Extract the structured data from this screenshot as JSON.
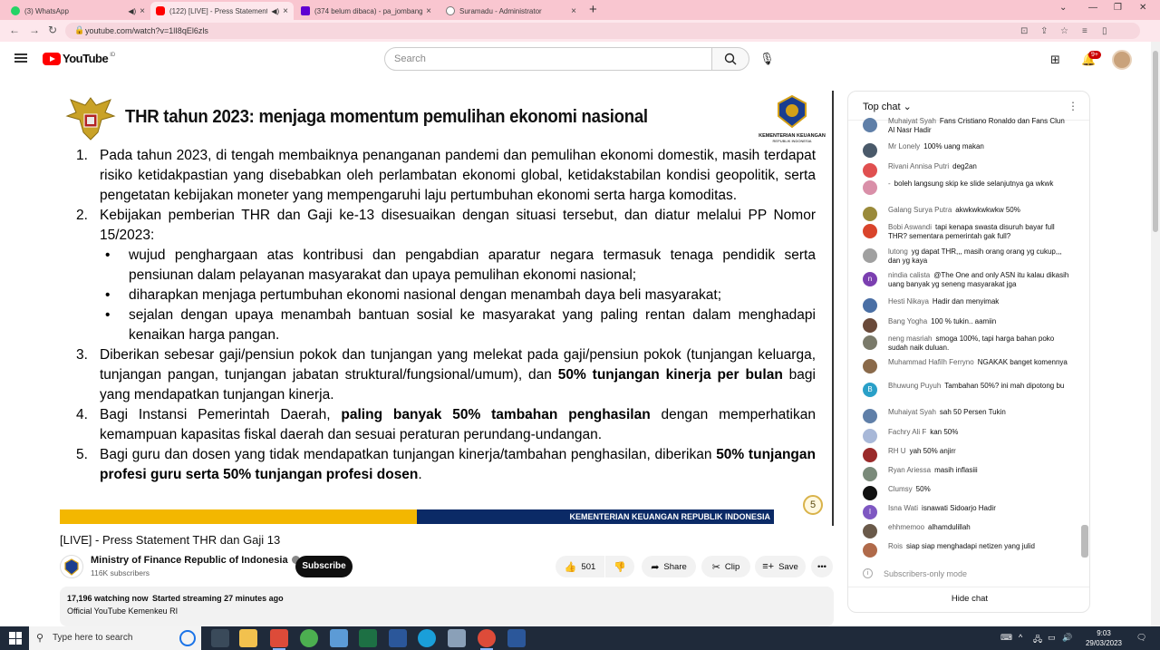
{
  "browser": {
    "tabs": [
      {
        "title": "(3) WhatsApp",
        "color": "#25d366"
      },
      {
        "title": "(122) [LIVE] - Press Statement",
        "color": "#ff0000"
      },
      {
        "title": "(374 belum dibaca) - pa_jombang",
        "color": "#6001d2"
      },
      {
        "title": "Suramadu - Administrator",
        "color": "#777777"
      }
    ],
    "url": "youtube.com/watch?v=1lI8qEl6zls"
  },
  "youtube": {
    "logo_text": "YouTube",
    "logo_region": "ID",
    "search_placeholder": "Search",
    "notification_count": "9+"
  },
  "slide": {
    "title": "THR tahun 2023: menjaga momentum pemulihan ekonomi nasional",
    "logo_line1": "KEMENTERIAN KEUANGAN",
    "logo_line2": "REPUBLIK INDONESIA",
    "point1": "Pada tahun 2023, di tengah membaiknya penanganan pandemi dan pemulihan ekonomi domestik, masih terdapat risiko ketidakpastian yang disebabkan oleh perlambatan ekonomi global, ketidakstabilan kondisi geopolitik, serta pengetatan kebijakan moneter yang mempengaruhi laju pertumbuhan ekonomi serta harga komoditas.",
    "point2": "Kebijakan pemberian THR dan Gaji ke-13 disesuaikan dengan situasi tersebut, dan diatur melalui PP Nomor 15/2023:",
    "bullet1": "wujud penghargaan atas kontribusi dan pengabdian aparatur negara termasuk tenaga pendidik serta pensiunan dalam pelayanan masyarakat dan upaya pemulihan ekonomi nasional;",
    "bullet2": "diharapkan menjaga pertumbuhan ekonomi nasional dengan menambah daya beli masyarakat;",
    "bullet3": "sejalan dengan upaya menambah bantuan sosial ke masyarakat yang paling rentan dalam menghadapi kenaikan harga pangan.",
    "point3_a": "Diberikan sebesar gaji/pensiun pokok dan tunjangan yang melekat pada gaji/pensiun pokok (tunjangan keluarga, tunjangan pangan, tunjangan jabatan struktural/fungsional/umum), dan ",
    "point3_b": "50% tunjangan kinerja per bulan",
    "point3_c": " bagi yang mendapatkan tunjangan kinerja.",
    "point4_a": "Bagi Instansi Pemerintah Daerah, ",
    "point4_b": "paling banyak 50% tambahan penghasilan",
    "point4_c": " dengan memperhatikan kemampuan kapasitas fiskal daerah dan sesuai peraturan perundang-undangan.",
    "point5_a": "Bagi guru dan dosen yang tidak mendapatkan tunjangan kinerja/tambahan penghasilan, diberikan ",
    "point5_b": "50% tunjangan profesi guru serta 50% tunjangan profesi dosen",
    "point5_c": ".",
    "footer": "KEMENTERIAN KEUANGAN REPUBLIK INDONESIA",
    "page": "5"
  },
  "video": {
    "title": "[LIVE] - Press Statement THR dan Gaji 13",
    "channel": "Ministry of Finance Republic of Indonesia",
    "subscribers": "116K subscribers",
    "subscribe_label": "Subscribe",
    "likes": "501",
    "share_label": "Share",
    "clip_label": "Clip",
    "save_label": "Save",
    "watching": "17,196 watching now",
    "started": "Started streaming 27 minutes ago",
    "description": "Official YouTube Kemenkeu RI"
  },
  "chat": {
    "header": "Top chat",
    "messages": [
      {
        "author": "Muhaiyat Syah",
        "text": "Fans Cristiano Ronaldo dan Fans Clun Al Nasr Hadir",
        "color": "#5f7fa8"
      },
      {
        "author": "Mr Lonely",
        "text": "100% uang makan",
        "color": "#4a5a6a"
      },
      {
        "author": "Rivani Annisa Putri",
        "text": "deg2an",
        "color": "#e05050"
      },
      {
        "author": "-",
        "text": "boleh langsung skip ke slide selanjutnya ga wkwk",
        "color": "#d98fa8"
      },
      {
        "author": "Galang Surya Putra",
        "text": "akwkwkwkwkw 50%",
        "color": "#9a8a3a"
      },
      {
        "author": "Bobi Aswandi",
        "text": "tapi kenapa swasta disuruh bayar full THR? sementara pemerintah gak full?",
        "color": "#d9442b"
      },
      {
        "author": "lutong",
        "text": "yg dapat THR,,, masih orang orang yg cukup,,, dan yg kaya",
        "color": "#a0a0a0"
      },
      {
        "author": "nindia calista",
        "text": "@The One and only ASN itu kalau dikasih uang banyak yg seneng masyarakat jga",
        "color": "#7b3fb0"
      },
      {
        "author": "Hesti Nikaya",
        "text": "Hadir dan menyimak",
        "color": "#4a6fa5"
      },
      {
        "author": "Bang Yogha",
        "text": "100 % tukin.. aamiin",
        "color": "#6a4a3a"
      },
      {
        "author": "neng masriah",
        "text": "smoga 100%, tapi harga bahan poko sudah naik duluan.",
        "color": "#7a7a6a"
      },
      {
        "author": "Muhammad Hafilh Ferryno",
        "text": "NGAKAK banget komennya",
        "color": "#8a6a4a"
      },
      {
        "author": "Bhuwung Puyuh",
        "text": "Tambahan 50%? ini mah dipotong bu",
        "color": "#2aa0c8"
      },
      {
        "author": "Muhaiyat Syah",
        "text": "sah 50 Persen Tukin",
        "color": "#5f7fa8"
      },
      {
        "author": "Fachry Ali F",
        "text": "kan 50%",
        "color": "#a8b8d8"
      },
      {
        "author": "RH U",
        "text": "yah 50% anjirr",
        "color": "#9a2a2a"
      },
      {
        "author": "Ryan Ariessa",
        "text": "masih inflasiii",
        "color": "#7a8a7a"
      },
      {
        "author": "Clumsy",
        "text": "50%",
        "color": "#111111"
      },
      {
        "author": "Isna Wati",
        "text": "isnawati Sidoarjo Hadir",
        "color": "#7e57c2"
      },
      {
        "author": "ehhmemoo",
        "text": "alhamdulillah",
        "color": "#6a5a4a"
      },
      {
        "author": "Rois",
        "text": "siap siap menghadapi netizen yang julid",
        "color": "#b06a4a"
      }
    ],
    "subscribers_only": "Subscribers-only mode",
    "hide_chat": "Hide chat"
  },
  "taskbar": {
    "search_placeholder": "Type here to search",
    "time": "9:03",
    "date": "29/03/2023"
  }
}
